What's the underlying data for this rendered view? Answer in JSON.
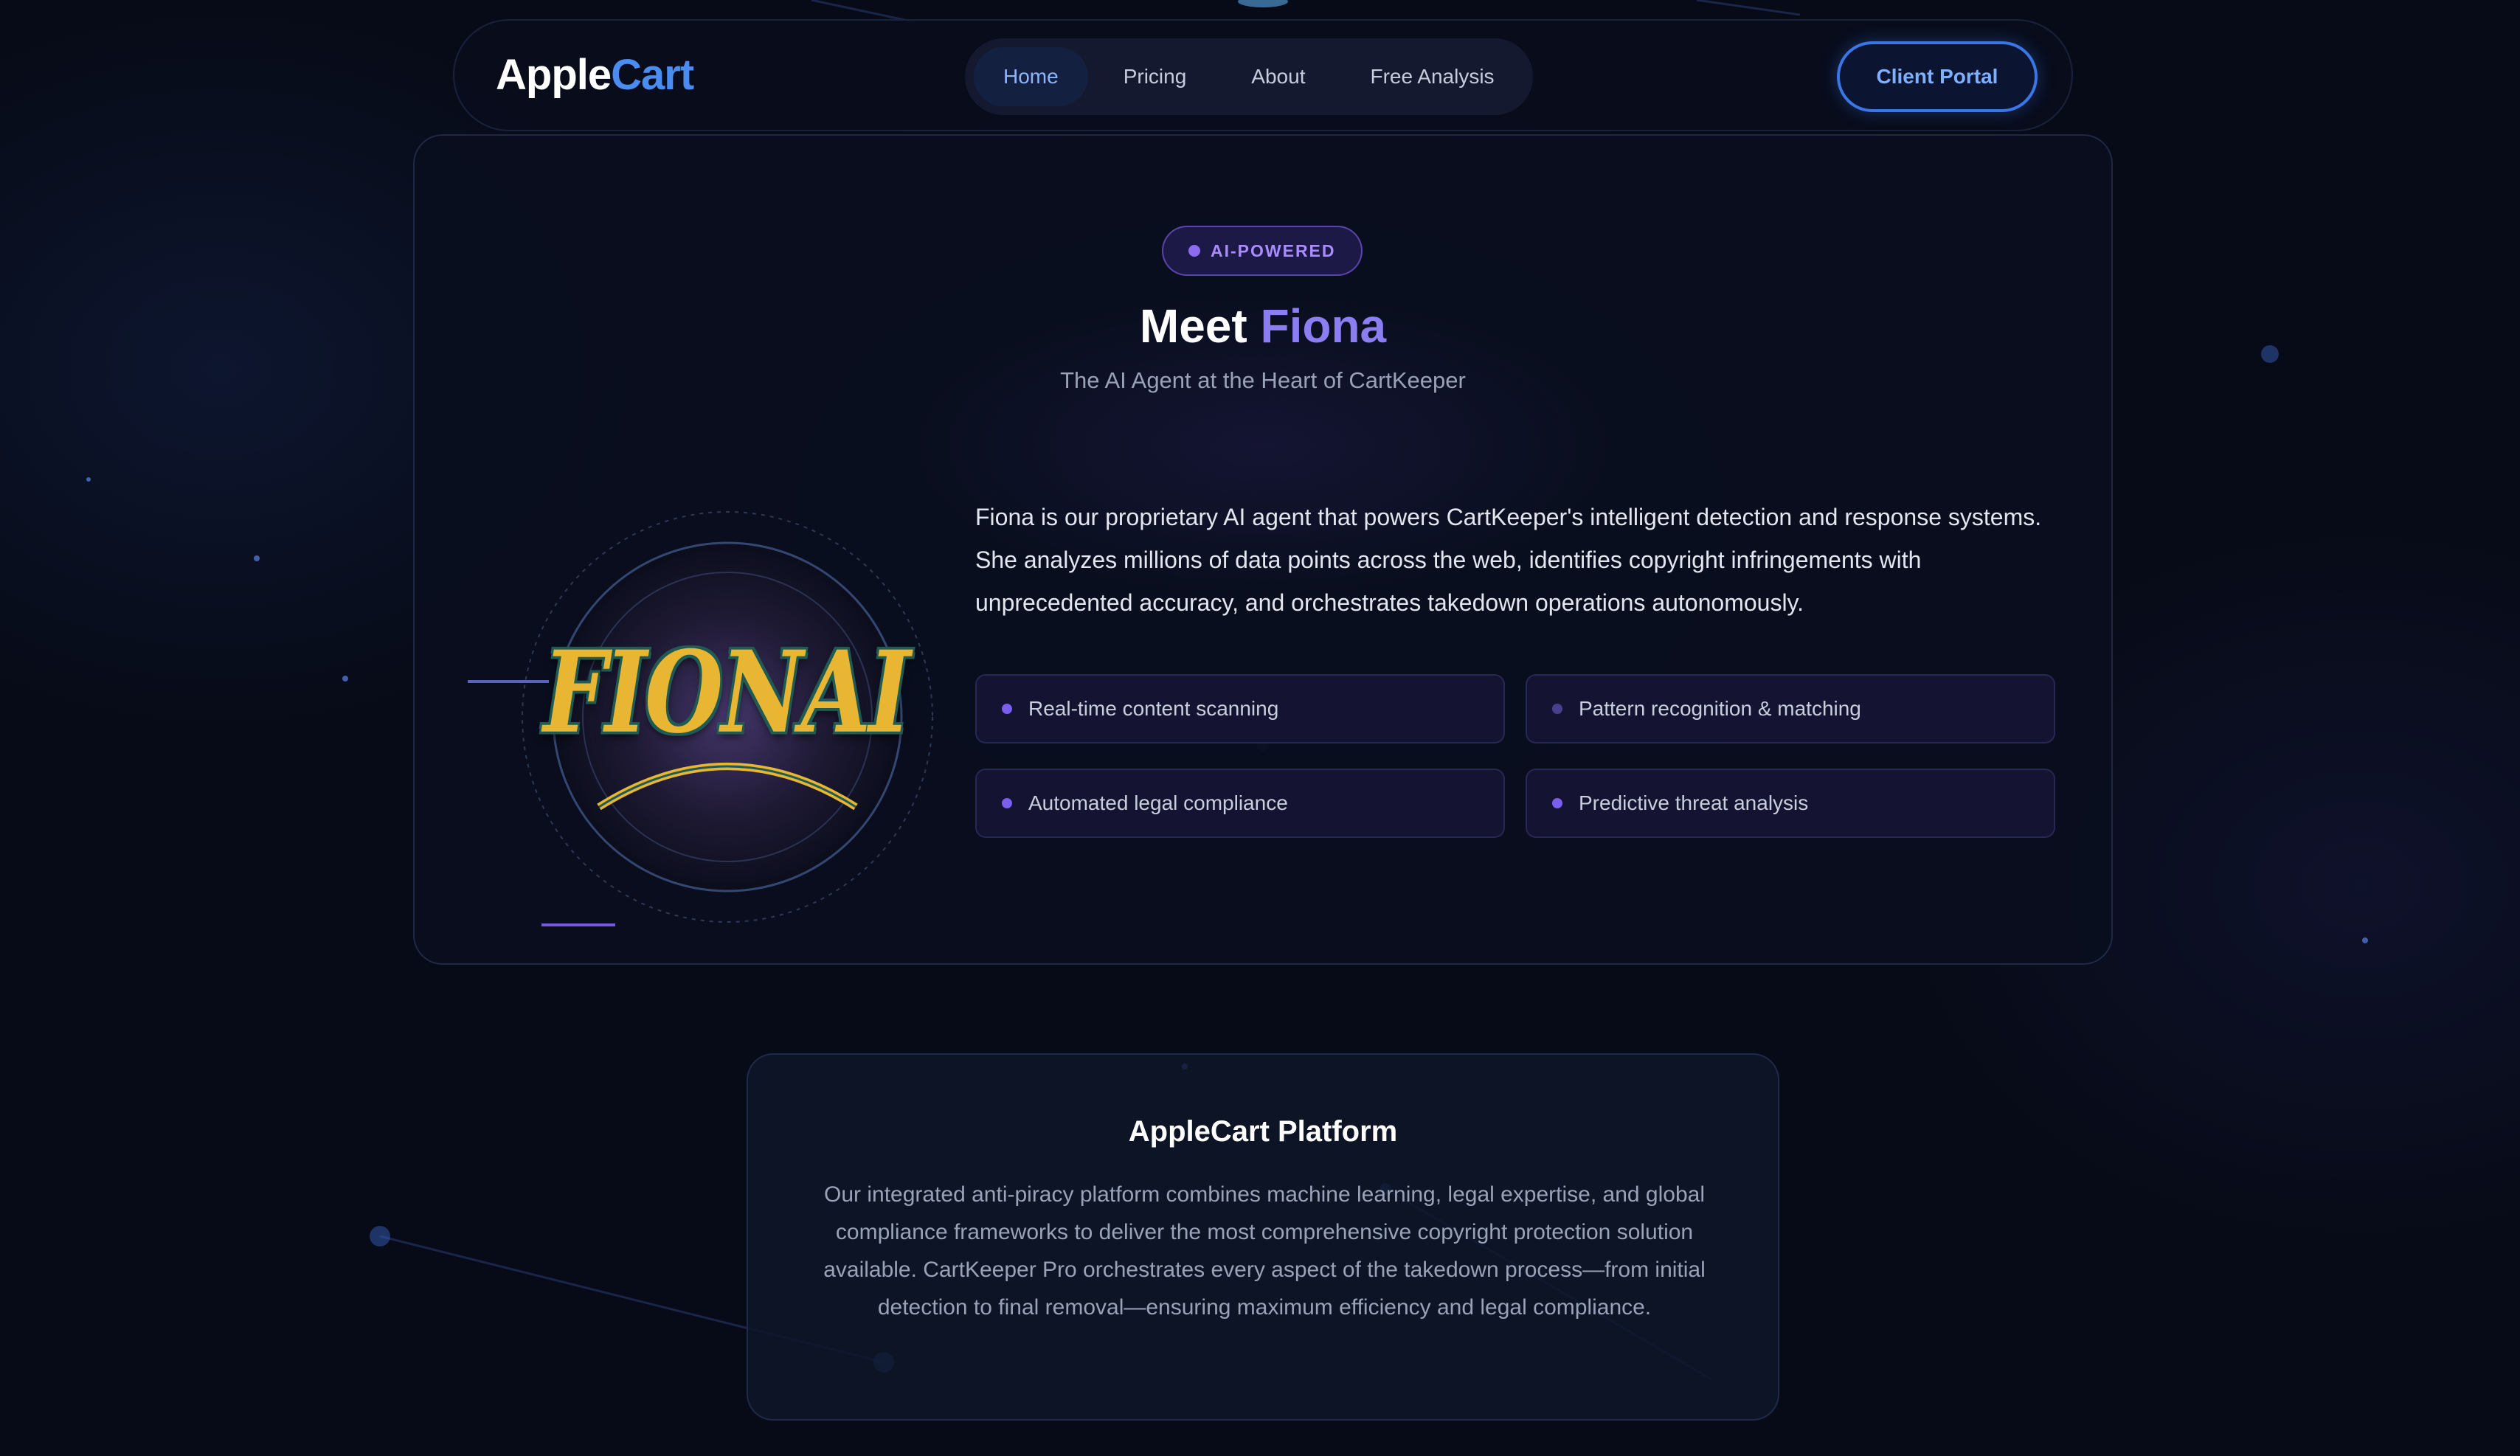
{
  "brand": {
    "name_part1": "Apple",
    "name_part2": "Cart"
  },
  "nav": {
    "links": [
      {
        "label": "Home",
        "active": true
      },
      {
        "label": "Pricing",
        "active": false
      },
      {
        "label": "About",
        "active": false
      },
      {
        "label": "Free Analysis",
        "active": false
      }
    ],
    "portal_button": "Client Portal"
  },
  "hero": {
    "badge": "AI-POWERED",
    "title_part1": "Meet",
    "title_part2": "Fiona",
    "subtitle": "The AI Agent at the Heart of CartKeeper",
    "logo_text": "FIONAI",
    "description": "Fiona is our proprietary AI agent that powers CartKeeper's intelligent detection and response systems. She analyzes millions of data points across the web, identifies copyright infringements with unprecedented accuracy, and orchestrates takedown operations autonomously.",
    "features": [
      "Real-time content scanning",
      "Pattern recognition & matching",
      "Automated legal compliance",
      "Predictive threat analysis"
    ]
  },
  "platform": {
    "title": "AppleCart Platform",
    "text": "Our integrated anti-piracy platform combines machine learning, legal expertise, and global compliance frameworks to deliver the most comprehensive copyright protection solution available. CartKeeper Pro orchestrates every aspect of the takedown process—from initial detection to final removal—ensuring maximum efficiency and legal compliance."
  },
  "colors": {
    "background": "#070b17",
    "accent_blue": "#4a8cf0",
    "accent_purple": "#8a7ef0",
    "logo_gold": "#e9b634"
  }
}
